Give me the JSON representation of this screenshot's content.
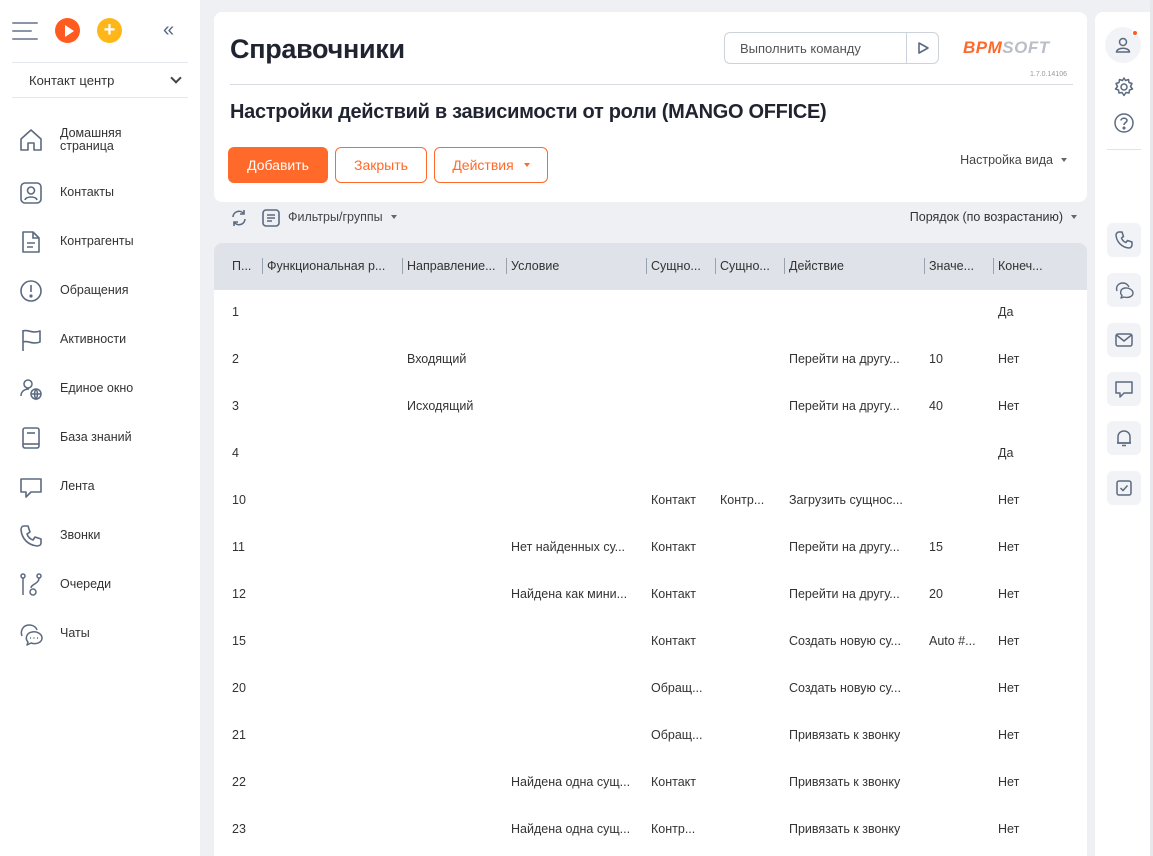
{
  "sidebar": {
    "workspace": "Контакт центр",
    "items": [
      {
        "label": "Домашняя страница",
        "icon": "home-icon"
      },
      {
        "label": "Контакты",
        "icon": "contacts-icon"
      },
      {
        "label": "Контрагенты",
        "icon": "document-icon"
      },
      {
        "label": "Обращения",
        "icon": "exclamation-icon"
      },
      {
        "label": "Активности",
        "icon": "flag-icon"
      },
      {
        "label": "Единое окно",
        "icon": "person-globe-icon"
      },
      {
        "label": "База знаний",
        "icon": "book-icon"
      },
      {
        "label": "Лента",
        "icon": "feed-icon"
      },
      {
        "label": "Звонки",
        "icon": "phone-icon"
      },
      {
        "label": "Очереди",
        "icon": "queue-icon"
      },
      {
        "label": "Чаты",
        "icon": "chats-icon"
      }
    ]
  },
  "header": {
    "title": "Справочники",
    "command_placeholder": "Выполнить команду",
    "logo_part1": "BPM",
    "logo_part2": "SOFT",
    "version": "1.7.0.14106",
    "subtitle": "Настройки действий в зависимости от роли (MANGO OFFICE)",
    "add_label": "Добавить",
    "close_label": "Закрыть",
    "actions_label": "Действия",
    "view_settings_label": "Настройка вида"
  },
  "filterbar": {
    "filters_label": "Фильтры/группы",
    "sort_label": "Порядок (по возрастанию)"
  },
  "grid": {
    "columns": [
      "П...",
      "Функциональная р...",
      "Направление...",
      "Условие",
      "Сущно...",
      "Сущно...",
      "Действие",
      "Значе...",
      "Конеч..."
    ],
    "rows": [
      [
        "1",
        "",
        "",
        "",
        "",
        "",
        "",
        "",
        "Да"
      ],
      [
        "2",
        "",
        "Входящий",
        "",
        "",
        "",
        "Перейти на другу...",
        "10",
        "Нет"
      ],
      [
        "3",
        "",
        "Исходящий",
        "",
        "",
        "",
        "Перейти на другу...",
        "40",
        "Нет"
      ],
      [
        "4",
        "",
        "",
        "",
        "",
        "",
        "",
        "",
        "Да"
      ],
      [
        "10",
        "",
        "",
        "",
        "Контакт",
        "Контр...",
        "Загрузить сущнос...",
        "",
        "Нет"
      ],
      [
        "11",
        "",
        "",
        "Нет найденных су...",
        "Контакт",
        "",
        "Перейти на другу...",
        "15",
        "Нет"
      ],
      [
        "12",
        "",
        "",
        "Найдена как мини...",
        "Контакт",
        "",
        "Перейти на другу...",
        "20",
        "Нет"
      ],
      [
        "15",
        "",
        "",
        "",
        "Контакт",
        "",
        "Создать новую су...",
        "Auto #...",
        "Нет"
      ],
      [
        "20",
        "",
        "",
        "",
        "Обращ...",
        "",
        "Создать новую су...",
        "",
        "Нет"
      ],
      [
        "21",
        "",
        "",
        "",
        "Обращ...",
        "",
        "Привязать к звонку",
        "",
        "Нет"
      ],
      [
        "22",
        "",
        "",
        "Найдена одна сущ...",
        "Контакт",
        "",
        "Привязать к звонку",
        "",
        "Нет"
      ],
      [
        "23",
        "",
        "",
        "Найдена одна сущ...",
        "Контр...",
        "",
        "Привязать к звонку",
        "",
        "Нет"
      ]
    ]
  },
  "rightbar": {
    "icons": [
      "user-icon",
      "gear-icon",
      "help-icon",
      "phone-icon",
      "chat-icon",
      "email-icon",
      "message-icon",
      "bell-icon",
      "task-check-icon"
    ]
  },
  "colors": {
    "accent": "#ff6a2b",
    "play": "#ff5a1f",
    "add": "#ffb619",
    "grid_header": "#dfe2e8",
    "background": "#eef0f4"
  }
}
